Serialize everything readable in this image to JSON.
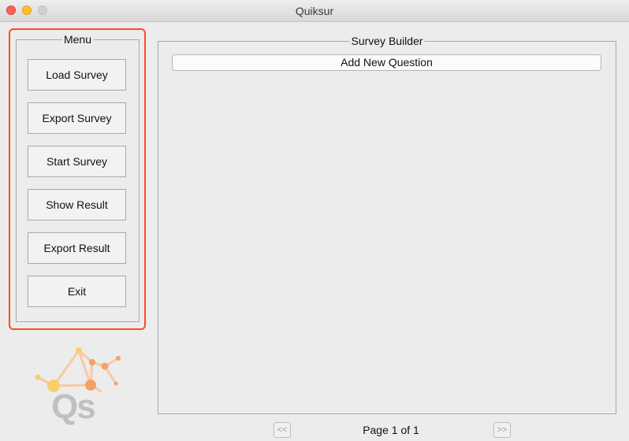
{
  "window": {
    "title": "Quiksur"
  },
  "menu": {
    "legend": "Menu",
    "buttons": [
      {
        "label": "Load Survey"
      },
      {
        "label": "Export Survey"
      },
      {
        "label": "Start Survey"
      },
      {
        "label": "Show Result"
      },
      {
        "label": "Export Result"
      },
      {
        "label": "Exit"
      }
    ]
  },
  "builder": {
    "legend": "Survey Builder",
    "add_question_label": "Add New Question"
  },
  "logo": {
    "text": "Qs"
  },
  "pager": {
    "prev_label": "<<",
    "next_label": ">>",
    "page_text": "Page 1 of 1"
  },
  "colors": {
    "highlight": "#ff4d1f",
    "logo_orange": "#f5a06a",
    "logo_yellow": "#f7d06b",
    "logo_text": "#c0c0c0"
  }
}
